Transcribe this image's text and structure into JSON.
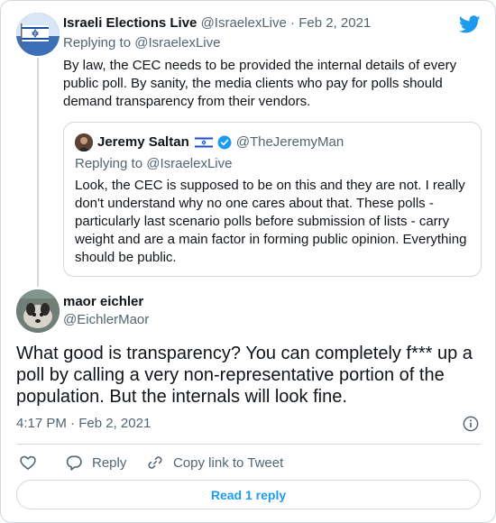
{
  "parent": {
    "name": "Israeli Elections Live",
    "handle": "@IsraelexLive",
    "separator": "·",
    "date": "Feb 2, 2021",
    "replying_to": "Replying to @IsraelexLive",
    "text": "By law, the CEC needs to be provided the internal details of every public poll. By sanity, the media clients who pay for polls should demand transparency from their vendors."
  },
  "quote": {
    "name": "Jeremy Saltan",
    "handle": "@TheJeremyMan",
    "replying_to": "Replying to @IsraelexLive",
    "text": "Look, the CEC is supposed to be on this and they are not. I really don't understand why no one cares about that. These polls - particularly last scenario polls before submission of lists - carry weight and are a main factor in forming public opinion. Everything should be public."
  },
  "main": {
    "name": "maor eichler",
    "handle": "@EichlerMaor",
    "text": "What good is transparency? You can completely f*** up a poll by calling a very non-representative portion of the population. But the internals will look fine.",
    "time": "4:17 PM",
    "separator": "·",
    "date": "Feb 2, 2021"
  },
  "actions": {
    "reply_label": "Reply",
    "copy_label": "Copy link to Tweet"
  },
  "read_replies_label": "Read 1 reply",
  "colors": {
    "accent": "#1d9bf0",
    "text": "#0f1419",
    "secondary": "#536471",
    "border": "#cfd9de"
  },
  "icons": [
    "twitter-bird-icon",
    "israel-flag-icon",
    "verified-badge-icon",
    "info-icon",
    "heart-icon",
    "reply-icon",
    "link-icon"
  ]
}
